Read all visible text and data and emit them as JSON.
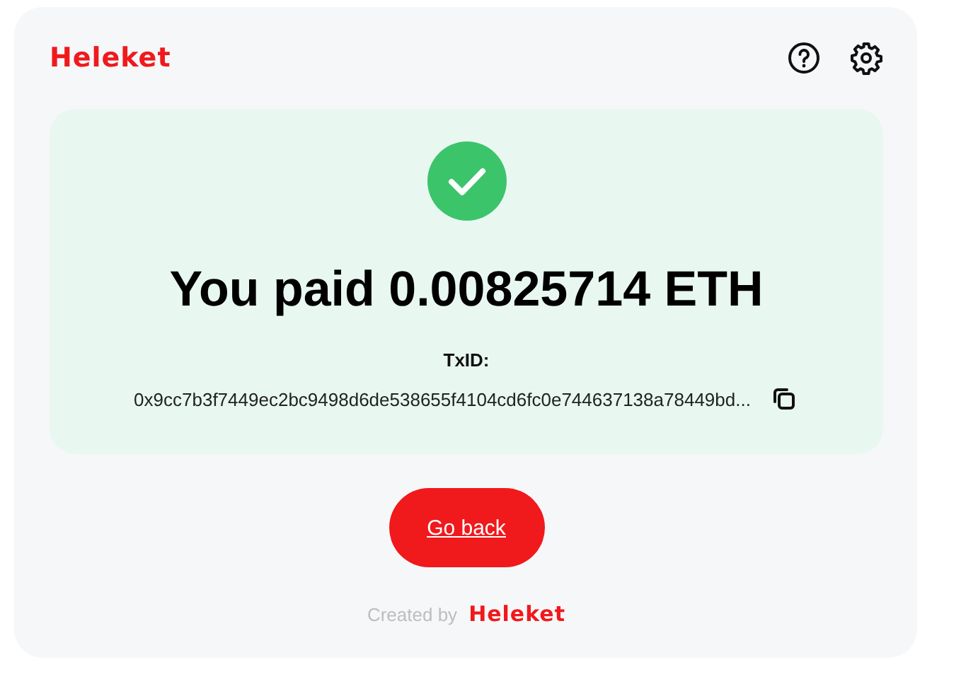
{
  "header": {
    "logo": "Heleket"
  },
  "result": {
    "paid": true,
    "title": "You paid 0.00825714 ETH",
    "txid_label": "TxID:",
    "txid": "0x9cc7b3f7449ec2bc9498d6de538655f4104cd6fc0e744637138a78449bd..."
  },
  "button": "Go back",
  "footer": {
    "text": "Created by",
    "logo": "Heleket"
  }
}
